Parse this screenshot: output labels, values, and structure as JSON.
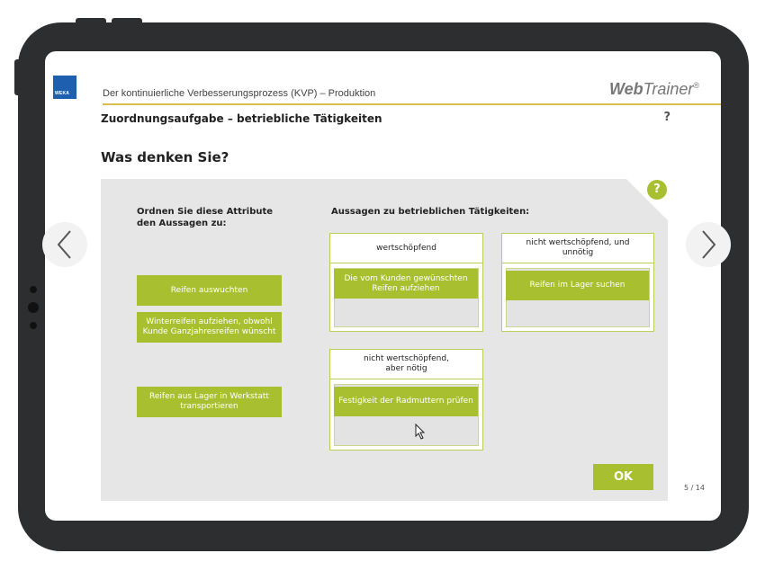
{
  "app": {
    "title": "Der kontinuierliche Verbesserungsprozess (KVP) – Produktion",
    "logo_text": "WEKA",
    "brand_bold": "Web",
    "brand_light": "Trainer",
    "brand_reg": "®"
  },
  "section": {
    "title": "Zuordnungsaufgabe – betriebliche Tätigkeiten",
    "help": "?"
  },
  "question": "Was denken Sie?",
  "panel": {
    "help": "?",
    "instruction": "Ordnen Sie diese Attribute den Aussagen zu:",
    "statements_heading": "Aussagen zu betrieblichen Tätigkeiten:"
  },
  "attributes": [
    "Reifen auswuchten",
    "Winterreifen aufziehen, obwohl Kunde Ganzjahresreifen wünscht",
    "Reifen aus Lager in Werkstatt transportieren"
  ],
  "categories": [
    {
      "label": "wertschöpfend",
      "placed": "Die vom Kunden gewünschten Reifen aufziehen"
    },
    {
      "label": "nicht wertschöpfend, und unnötig",
      "placed": "Reifen im Lager suchen"
    },
    {
      "label": "nicht wertschöpfend, aber nötig",
      "placed": "Festigkeit der Radmuttern prüfen"
    }
  ],
  "ok_label": "OK",
  "pager": "5 / 14",
  "colors": {
    "accent": "#a8c030",
    "accent_border": "#b9cf55",
    "panel_bg": "#e6e6e6",
    "logo_blue": "#1f5fb0",
    "divider_yellow": "#d9c04a"
  }
}
